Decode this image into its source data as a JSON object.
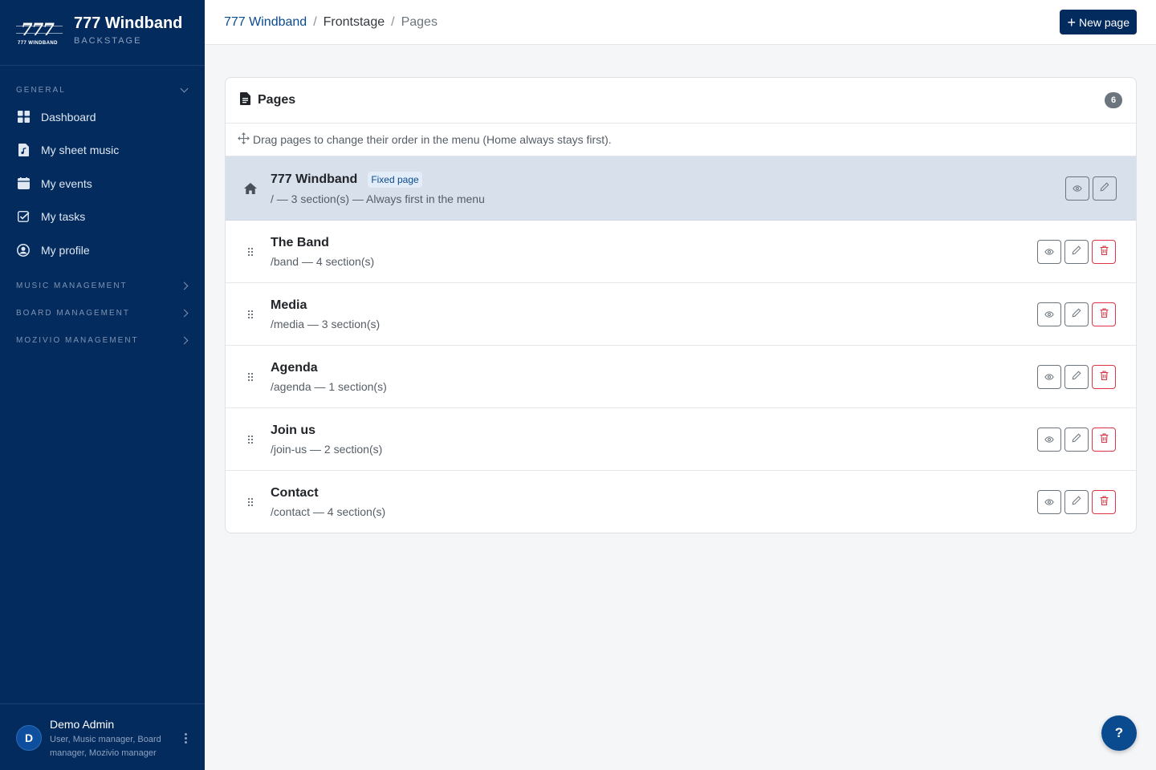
{
  "sidebar": {
    "brand": {
      "logo_digits": "777",
      "logo_text": "777 WINDBAND",
      "title": "777 Windband",
      "subtitle": "BACKSTAGE"
    },
    "sections": {
      "general": "GENERAL",
      "music": "MUSIC MANAGEMENT",
      "board": "BOARD MANAGEMENT",
      "mozivio": "MOZIVIO MANAGEMENT"
    },
    "items": [
      {
        "label": "Dashboard",
        "icon": "dashboard-icon"
      },
      {
        "label": "My sheet music",
        "icon": "music-file-icon"
      },
      {
        "label": "My events",
        "icon": "calendar-icon"
      },
      {
        "label": "My tasks",
        "icon": "checkbox-icon"
      },
      {
        "label": "My profile",
        "icon": "user-circle-icon"
      }
    ],
    "user": {
      "initial": "D",
      "name": "Demo Admin",
      "roles": "User, Music manager, Board manager, Mozivio manager"
    }
  },
  "topbar": {
    "breadcrumb": [
      "777 Windband",
      "Frontstage",
      "Pages"
    ],
    "separator": "/",
    "new_page_label": "New page",
    "new_page_plus": "+"
  },
  "card": {
    "title": "Pages",
    "count": "6",
    "hint": "Drag pages to change their order in the menu (Home always stays first)."
  },
  "home_page": {
    "title": "777 Windband",
    "badge": "Fixed page",
    "subtitle": "/ — 3 section(s) — Always first in the menu"
  },
  "pages": [
    {
      "title": "The Band",
      "subtitle": "/band — 4 section(s)"
    },
    {
      "title": "Media",
      "subtitle": "/media — 3 section(s)"
    },
    {
      "title": "Agenda",
      "subtitle": "/agenda — 1 section(s)"
    },
    {
      "title": "Join us",
      "subtitle": "/join-us — 2 section(s)"
    },
    {
      "title": "Contact",
      "subtitle": "/contact — 4 section(s)"
    }
  ],
  "help_label": "?",
  "colors": {
    "sidebar": "#032b5e",
    "primary": "#0a4a8f",
    "danger": "#dc3545",
    "home_row": "#d8e0eb"
  }
}
